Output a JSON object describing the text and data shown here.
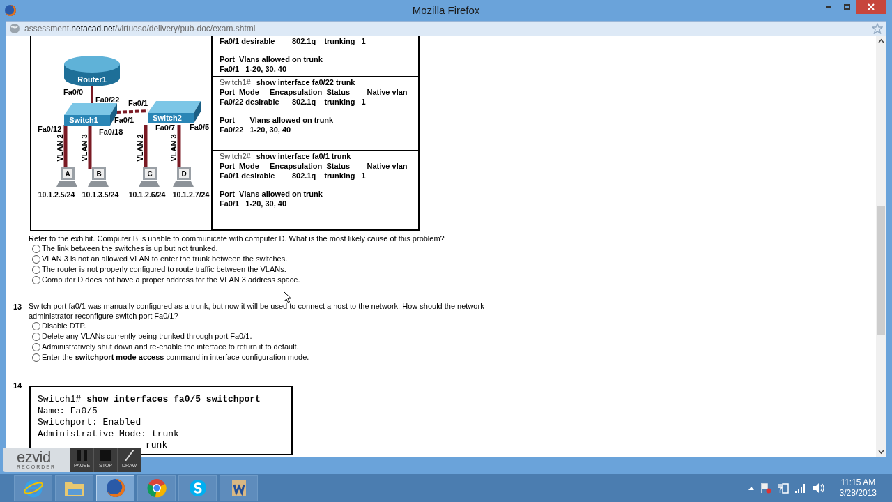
{
  "window": {
    "title": "Mozilla Firefox"
  },
  "address_bar": {
    "url_prefix": "assessment.",
    "url_domain": "netacad.net",
    "url_path": "/virtuoso/delivery/pub-doc/exam.shtml"
  },
  "exhibit": {
    "diagram": {
      "router": "Router1",
      "switches": [
        "Switch1",
        "Switch2"
      ],
      "ports": [
        "Fa0/0",
        "Fa0/22",
        "Fa0/1",
        "Fa0/1",
        "Fa0/12",
        "Fa0/18",
        "Fa0/7",
        "Fa0/5"
      ],
      "vlans": [
        "VLAN 2",
        "VLAN 3",
        "VLAN 2",
        "VLAN 3"
      ],
      "hosts": [
        {
          "label": "A",
          "address": "10.1.2.5/24"
        },
        {
          "label": "B",
          "address": "10.1.3.5/24"
        },
        {
          "label": "C",
          "address": "10.1.2.6/24"
        },
        {
          "label": "D",
          "address": "10.1.2.7/24"
        }
      ]
    },
    "outputs": [
      {
        "blocks": [
          [
            "Fa0/1 desirable        802.1q    trunking   1"
          ],
          [
            "Port  Vlans allowed on trunk",
            "Fa0/1   1-20, 30, 40"
          ]
        ]
      },
      {
        "prompt": "Switch1#",
        "command": "show interface fa0/22 trunk",
        "blocks": [
          [
            "Port  Mode     Encapsulation  Status        Native vlan",
            "Fa0/22 desirable      802.1q    trunking   1"
          ],
          [
            "Port       Vlans allowed on trunk",
            "Fa0/22   1-20, 30, 40"
          ]
        ]
      },
      {
        "prompt": "Switch2#",
        "command": "show interface fa0/1 trunk",
        "blocks": [
          [
            "Port  Mode     Encapsulation  Status        Native vlan",
            "Fa0/1 desirable        802.1q    trunking   1"
          ],
          [
            "Port  Vlans allowed on trunk",
            "Fa0/1   1-20, 30, 40"
          ]
        ]
      }
    ]
  },
  "questions": [
    {
      "text": "Refer to the exhibit. Computer B is unable to communicate with computer D. What is the most likely cause of this problem?",
      "options": [
        {
          "text": "The link between the switches is up but not trunked.",
          "selected": false
        },
        {
          "text": "VLAN 3 is not an allowed VLAN to enter the trunk between the switches.",
          "selected": false
        },
        {
          "text": "The router is not properly configured to route traffic between the VLANs.",
          "selected": false
        },
        {
          "text": "Computer D does not have a proper address for the VLAN 3 address space.",
          "selected": false
        }
      ]
    },
    {
      "number": "13",
      "text": "Switch port fa0/1 was manually configured as a trunk, but now it will be used to connect a host to the network. How should the network administrator reconfigure switch port Fa0/1?",
      "options": [
        {
          "text": "Disable DTP.",
          "selected": false
        },
        {
          "text": "Delete any VLANs currently being trunked through port Fa0/1.",
          "selected": false
        },
        {
          "text": "Administratively shut down and re-enable the interface to return it to default.",
          "selected": false
        },
        {
          "text": "Enter the **switchport mode access** command in interface configuration mode.",
          "selected": false
        }
      ]
    },
    {
      "number": "14",
      "code": {
        "prompt": "Switch1#",
        "command": "show interfaces fa0/5 switchport",
        "lines": [
          "Name: Fa0/5",
          "Switchport: Enabled",
          "Administrative Mode: trunk",
          "runk"
        ]
      }
    }
  ],
  "recorder": {
    "logo": "ezvid",
    "sublabel": "RECORDER",
    "buttons": [
      {
        "kind": "pause",
        "label": "PAUSE"
      },
      {
        "kind": "stop",
        "label": "STOP"
      },
      {
        "kind": "draw",
        "label": "DRAW"
      }
    ]
  },
  "taskbar": {
    "apps": [
      {
        "kind": "ie",
        "selected": false
      },
      {
        "kind": "folder",
        "selected": false
      },
      {
        "kind": "firefox",
        "selected": true
      },
      {
        "kind": "chrome",
        "selected": false
      },
      {
        "kind": "skype",
        "selected": false
      },
      {
        "kind": "word",
        "selected": false
      }
    ],
    "time": "11:15 AM",
    "date": "3/28/2013"
  }
}
